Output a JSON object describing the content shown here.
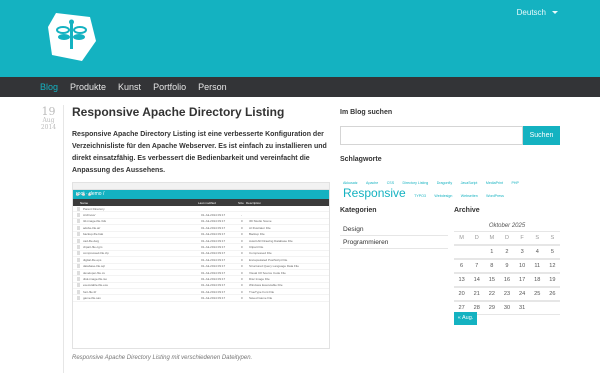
{
  "header": {
    "language": "Deutsch",
    "accent_color": "#14b2c1",
    "logo_icon": "dragonfly-logo-icon"
  },
  "nav": {
    "items": [
      {
        "label": "Blog",
        "active": true
      },
      {
        "label": "Produkte"
      },
      {
        "label": "Kunst"
      },
      {
        "label": "Portfolio"
      },
      {
        "label": "Person"
      }
    ]
  },
  "post": {
    "date": {
      "day": "19",
      "month": "Aug",
      "year": "2014"
    },
    "title": "Responsive Apache Directory Listing",
    "intro": "Responsive Apache Directory Listing ist eine verbesserte Konfiguration der Verzeichnisliste für den Apache Webserver. Es ist einfach zu installieren und direkt einsatzfähig. Es verbessert die Bedienbarkeit und vereinfacht die Anpassung des Aussehens.",
    "screenshot": {
      "bar_title": "root · demo /",
      "columns": [
        "Name",
        "Last modified",
        "Size",
        "Description"
      ],
      "rows": [
        [
          "Parent Directory",
          "",
          "",
          ""
        ],
        [
          "Archives/",
          "01-Jul-2014 09:17",
          "-",
          ""
        ],
        [
          "3d-image-file.3ds",
          "01-Jul-2014 09:17",
          "0",
          "3D Studio Scene"
        ],
        [
          "adobe-file.ai/",
          "01-Jul-2014 09:17",
          "0",
          "AI Illustrator File"
        ],
        [
          "backup-file.bak",
          "01-Jul-2014 09:17",
          "0",
          "Backup File"
        ],
        [
          "cad-file.dwg",
          "01-Jul-2014 09:17",
          "0",
          "AutoCAD Drawing Database File"
        ],
        [
          "clipart-file.cgm",
          "01-Jul-2014 09:17",
          "0",
          "Clipart File"
        ],
        [
          "compressed-file.zip",
          "01-Jul-2014 09:17",
          "0",
          "Compressed File"
        ],
        [
          "digital-file.eps",
          "01-Jul-2014 09:17",
          "0",
          "Encapsulated PostScript File"
        ],
        [
          "database-file.sql",
          "01-Jul-2014 09:17",
          "0",
          "Structured Query Language Data File"
        ],
        [
          "developer-file.cs",
          "01-Jul-2014 09:17",
          "0",
          "Visual C# Source Code File"
        ],
        [
          "disk-image-file.iso",
          "01-Jul-2014 09:17",
          "0",
          "Disc Image File"
        ],
        [
          "executable-file.exe",
          "01-Jul-2014 09:17",
          "0",
          "Windows Executable File"
        ],
        [
          "font-file.ttf",
          "01-Jul-2014 09:17",
          "0",
          "TrueType Font File"
        ],
        [
          "game-file.sav",
          "01-Jul-2014 09:17",
          "0",
          "Saved Game File"
        ]
      ]
    },
    "caption": "Responsive Apache Directory Listing mit verschiedenen Dateitypen."
  },
  "sidebar": {
    "search_heading": "Im Blog suchen",
    "search_placeholder": "",
    "search_button": "Suchen",
    "tags_heading": "Schlagworte",
    "tags_row1": [
      "Akkusatz",
      "Apache",
      "CSS",
      "Directory Listing",
      "Dragonfly",
      "JavaScript",
      "MediaPrint",
      "PHP"
    ],
    "tags_big": "Responsive",
    "tags_row2": [
      "TYPO3",
      "Webdesign",
      "Webseiten",
      "WordPress"
    ],
    "categories_heading": "Kategorien",
    "categories": [
      "Design",
      "Programmieren"
    ],
    "archive_heading": "Archive",
    "calendar": {
      "caption": "Oktober 2025",
      "weekdays": [
        "M",
        "D",
        "M",
        "D",
        "F",
        "S",
        "S"
      ],
      "weeks": [
        [
          "",
          "",
          "1",
          "2",
          "3",
          "4",
          "5"
        ],
        [
          "6",
          "7",
          "8",
          "9",
          "10",
          "11",
          "12"
        ],
        [
          "13",
          "14",
          "15",
          "16",
          "17",
          "18",
          "19"
        ],
        [
          "20",
          "21",
          "22",
          "23",
          "24",
          "25",
          "26"
        ],
        [
          "27",
          "28",
          "29",
          "30",
          "31",
          "",
          ""
        ]
      ],
      "prev_label": "« Aug."
    }
  }
}
